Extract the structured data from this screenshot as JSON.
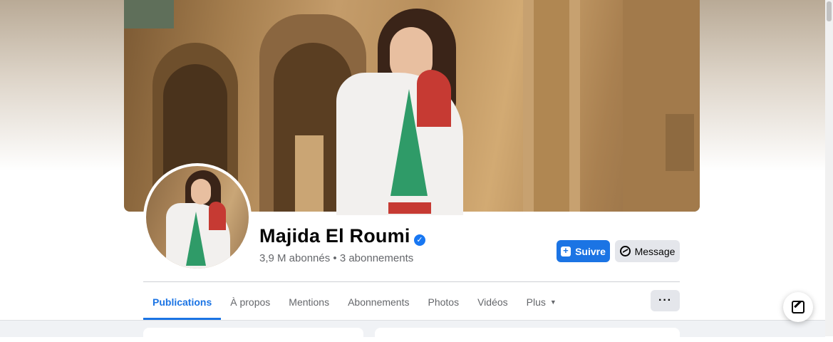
{
  "profile": {
    "name": "Majida El Roumi",
    "verified": true,
    "stats": "3,9 M abonnés • 3 abonnements"
  },
  "actions": {
    "follow_label": "Suivre",
    "message_label": "Message"
  },
  "tabs": [
    {
      "label": "Publications",
      "active": true
    },
    {
      "label": "À propos",
      "active": false
    },
    {
      "label": "Mentions",
      "active": false
    },
    {
      "label": "Abonnements",
      "active": false
    },
    {
      "label": "Photos",
      "active": false
    },
    {
      "label": "Vidéos",
      "active": false
    },
    {
      "label": "Plus",
      "active": false
    }
  ],
  "colors": {
    "accent": "#1b74e4",
    "text": "#050505",
    "muted": "#65676b"
  },
  "icons": [
    "verified-badge-icon",
    "follow-icon",
    "messenger-icon",
    "caret-down-icon",
    "more-options-icon",
    "compose-icon"
  ]
}
